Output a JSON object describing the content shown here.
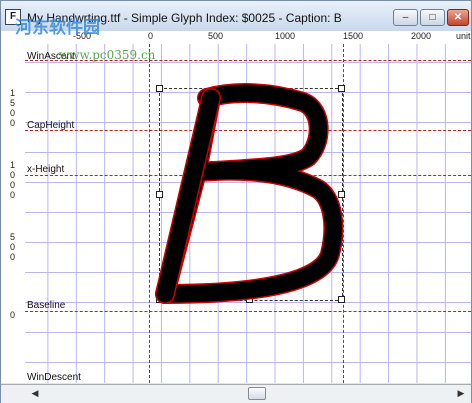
{
  "window": {
    "title": "My Handwrting.ttf - Simple Glyph Index: $0025 - Caption: B",
    "app_icon": "F",
    "minimize_glyph": "–",
    "maximize_glyph": "□",
    "close_glyph": "✕"
  },
  "ruler_top": {
    "labels": [
      "-500",
      "0",
      "500",
      "1000",
      "1500",
      "2000",
      "unit"
    ]
  },
  "ruler_left": {
    "digits": [
      "1",
      "5",
      "0",
      "0",
      "1",
      "0",
      "0",
      "0",
      "5",
      "0",
      "0",
      "0"
    ]
  },
  "metrics": {
    "ascent": "WinAscent",
    "cap_height": "CapHeight",
    "x_height": "x-Height",
    "baseline": "Baseline",
    "descent": "WinDescent"
  },
  "glyph": {
    "caption": "B",
    "index": "$0025",
    "stroke_color": "#000000",
    "outline_color": "#cc0000"
  },
  "scrollbar": {
    "left_arrow": "◀",
    "right_arrow": "▶"
  },
  "watermark": {
    "line1": "河东软件园",
    "line2": "www.pc0359.cn"
  },
  "colors": {
    "grid": "#b9b6f2",
    "metric_line": "#b22222",
    "titlebar": "#c8d8ec"
  }
}
